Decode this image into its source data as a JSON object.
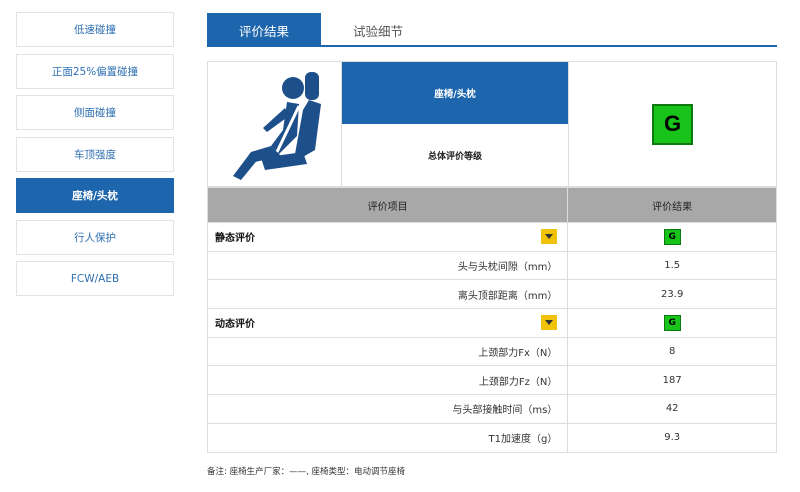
{
  "sidebar": {
    "items": [
      {
        "label": "低速碰撞",
        "active": false
      },
      {
        "label": "正面25%偏置碰撞",
        "active": false
      },
      {
        "label": "侧面碰撞",
        "active": false
      },
      {
        "label": "车顶强度",
        "active": false
      },
      {
        "label": "座椅/头枕",
        "active": true
      },
      {
        "label": "行人保护",
        "active": false
      },
      {
        "label": "FCW/AEB",
        "active": false
      }
    ]
  },
  "tabs": [
    {
      "label": "评价结果",
      "active": true
    },
    {
      "label": "试验细节",
      "active": false
    }
  ],
  "summary": {
    "category": "座椅/头枕",
    "overall_label": "总体评价等级",
    "overall_grade": "G"
  },
  "table": {
    "headers": [
      "评价项目",
      "评价结果"
    ],
    "sections": [
      {
        "title": "静态评价",
        "grade": "G",
        "rows": [
          {
            "label": "头与头枕间隙（mm）",
            "value": "1.5"
          },
          {
            "label": "离头顶部距离（mm）",
            "value": "23.9"
          }
        ]
      },
      {
        "title": "动态评价",
        "grade": "G",
        "rows": [
          {
            "label": "上颈部力Fx（N）",
            "value": "8"
          },
          {
            "label": "上颈部力Fz（N）",
            "value": "187"
          },
          {
            "label": "与头部接触时间（ms）",
            "value": "42"
          },
          {
            "label": "T1加速度（g）",
            "value": "9.3"
          }
        ]
      }
    ]
  },
  "note": "备注: 座椅生产厂家：——, 座椅类型：电动调节座椅",
  "colors": {
    "accent": "#1d66ae",
    "grade_good": "#18c31a",
    "dropdown": "#f0c20a",
    "header_gray": "#a8a8a8"
  },
  "icons": {
    "seat": "seat-headrest-icon",
    "dropdown": "chevron-down-icon"
  }
}
